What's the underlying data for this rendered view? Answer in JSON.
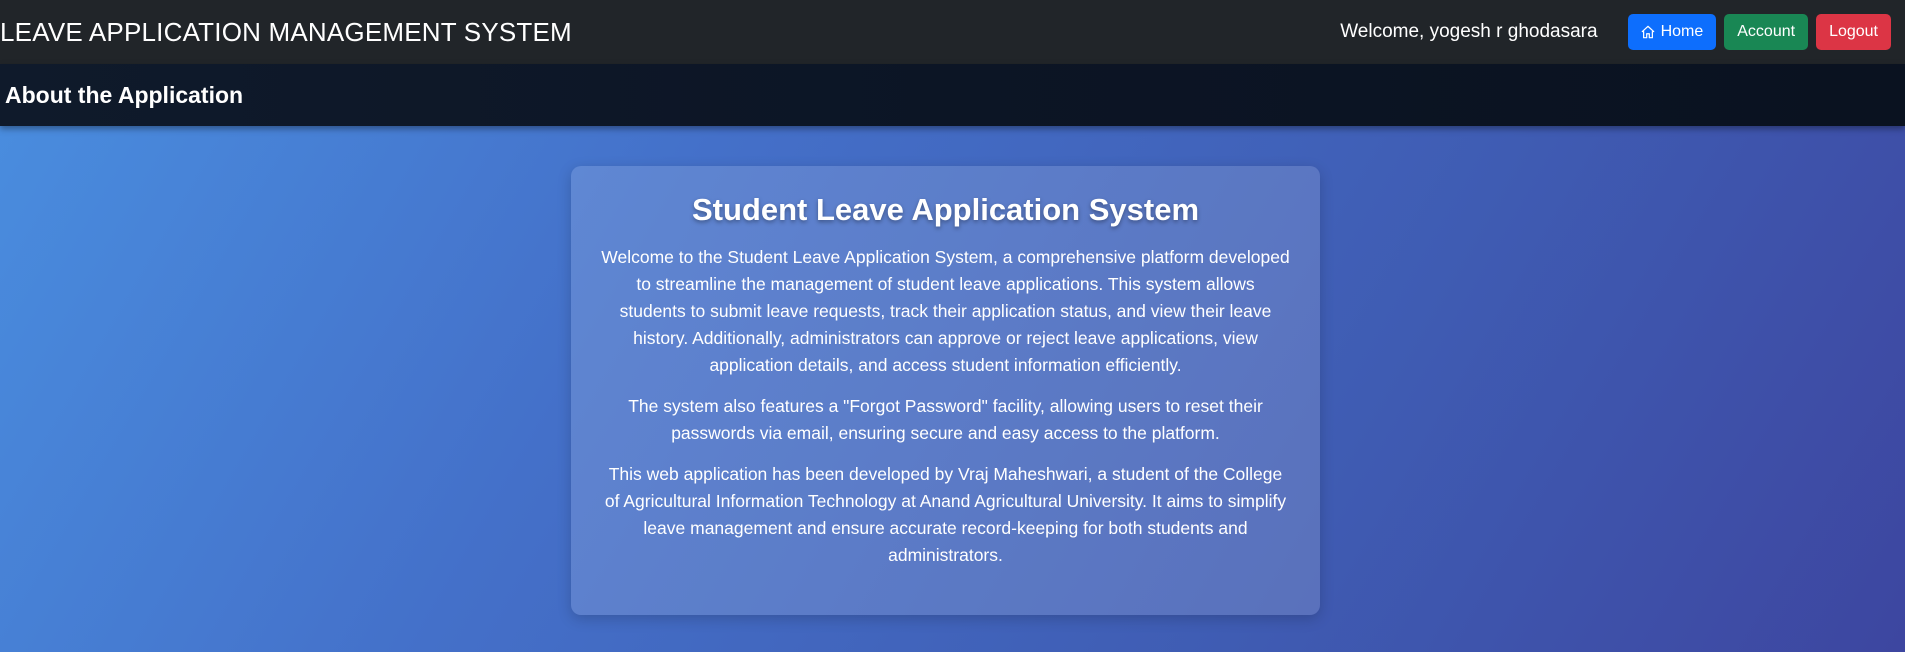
{
  "header": {
    "brand": "LEAVE APPLICATION MANAGEMENT SYSTEM",
    "welcome": "Welcome, yogesh r ghodasara",
    "home_label": "Home",
    "home_icon": "home-icon",
    "account_label": "Account",
    "logout_label": "Logout"
  },
  "subheader": {
    "title": "About the Application"
  },
  "card": {
    "title": "Student Leave Application System",
    "paragraphs": [
      "Welcome to the Student Leave Application System, a comprehensive platform developed to streamline the management of student leave applications. This system allows students to submit leave requests, track their application status, and view their leave history. Additionally, administrators can approve or reject leave applications, view application details, and access student information efficiently.",
      "The system also features a \"Forgot Password\" facility, allowing users to reset their passwords via email, ensuring secure and easy access to the platform.",
      "This web application has been developed by Vraj Maheshwari, a student of the College of Agricultural Information Technology at Anand Agricultural University. It aims to simplify leave management and ensure accurate record-keeping for both students and administrators."
    ]
  },
  "colors": {
    "navbar": "#212529",
    "home_button": "#0d6efd",
    "account_button": "#198754",
    "logout_button": "#dc3545"
  }
}
